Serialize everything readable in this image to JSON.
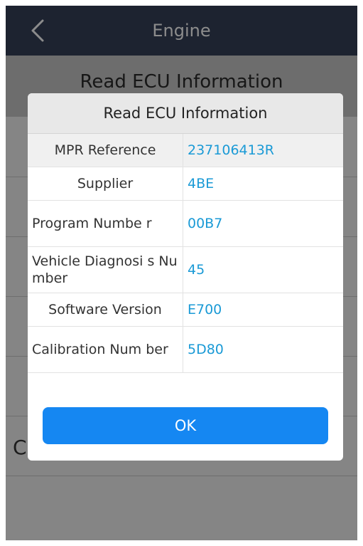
{
  "header": {
    "title": "Engine",
    "back_icon": "chevron-left-icon"
  },
  "subtitle": "Read ECU Information",
  "background_row_partial_text": "C        g          pp         r",
  "dialog": {
    "title": "Read ECU Information",
    "rows": [
      {
        "label": "MPR Reference",
        "value": "237106413R"
      },
      {
        "label": "Supplier",
        "value": "4BE"
      },
      {
        "label": "Program Numbe r",
        "value": "00B7"
      },
      {
        "label": "Vehicle Diagnosi s Number",
        "value": "45"
      },
      {
        "label": "Software Version",
        "value": "E700"
      },
      {
        "label": "Calibration Num ber",
        "value": "5D80"
      }
    ],
    "ok_label": "OK"
  },
  "colors": {
    "header_bg": "#354158",
    "value_text": "#1a9ad6",
    "ok_button": "#1587f2"
  }
}
